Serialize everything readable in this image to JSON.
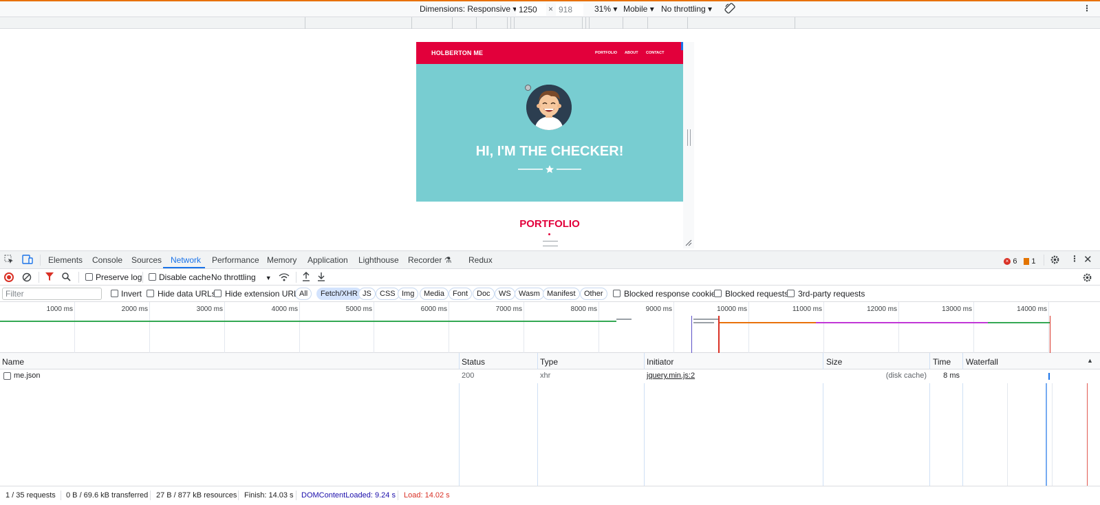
{
  "device_toolbar": {
    "dimensions_label": "Dimensions: Responsive",
    "width_value": "1250",
    "times": "×",
    "height_placeholder": "918",
    "zoom": "31%",
    "device_type": "Mobile",
    "throttling": "No throttling"
  },
  "site": {
    "brand": "HOLBERTON ME",
    "nav_links": [
      "PORTFOLIO",
      "ABOUT",
      "CONTACT"
    ],
    "hero_title": "HI, I'M THE CHECKER!",
    "section_title": "PORTFOLIO",
    "colors": {
      "primary": "#e2003b",
      "hero_bg": "#78cdd1"
    }
  },
  "devtools": {
    "tabs": [
      "Elements",
      "Console",
      "Sources",
      "Network",
      "Performance",
      "Memory",
      "Application",
      "Lighthouse",
      "Recorder",
      "Redux"
    ],
    "active_tab": "Network",
    "error_count": "6",
    "warning_count": "1",
    "toolbar": {
      "preserve_log": "Preserve log",
      "disable_cache": "Disable cache",
      "throttling": "No throttling"
    },
    "filter": {
      "placeholder": "Filter",
      "invert": "Invert",
      "hide_data_urls": "Hide data URLs",
      "hide_extension_urls": "Hide extension URLs",
      "types": [
        "All",
        "Fetch/XHR",
        "JS",
        "CSS",
        "Img",
        "Media",
        "Font",
        "Doc",
        "WS",
        "Wasm",
        "Manifest",
        "Other"
      ],
      "selected_type": "Fetch/XHR",
      "blocked_cookies": "Blocked response cookies",
      "blocked_requests": "Blocked requests",
      "third_party": "3rd-party requests"
    },
    "overview_ticks": [
      "1000 ms",
      "2000 ms",
      "3000 ms",
      "4000 ms",
      "5000 ms",
      "6000 ms",
      "7000 ms",
      "8000 ms",
      "9000 ms",
      "10000 ms",
      "11000 ms",
      "12000 ms",
      "13000 ms",
      "14000 ms"
    ],
    "columns": [
      "Name",
      "Status",
      "Type",
      "Initiator",
      "Size",
      "Time",
      "Waterfall"
    ],
    "requests": [
      {
        "name": "me.json",
        "status": "200",
        "type": "xhr",
        "initiator": "jquery.min.js:2",
        "size": "(disk cache)",
        "time": "8 ms"
      }
    ],
    "status_bar": {
      "requests": "1 / 35 requests",
      "transferred": "0 B / 69.6 kB transferred",
      "resources": "27 B / 877 kB resources",
      "finish": "Finish: 14.03 s",
      "dom_content_loaded": "DOMContentLoaded: 9.24 s",
      "load": "Load: 14.02 s"
    }
  }
}
